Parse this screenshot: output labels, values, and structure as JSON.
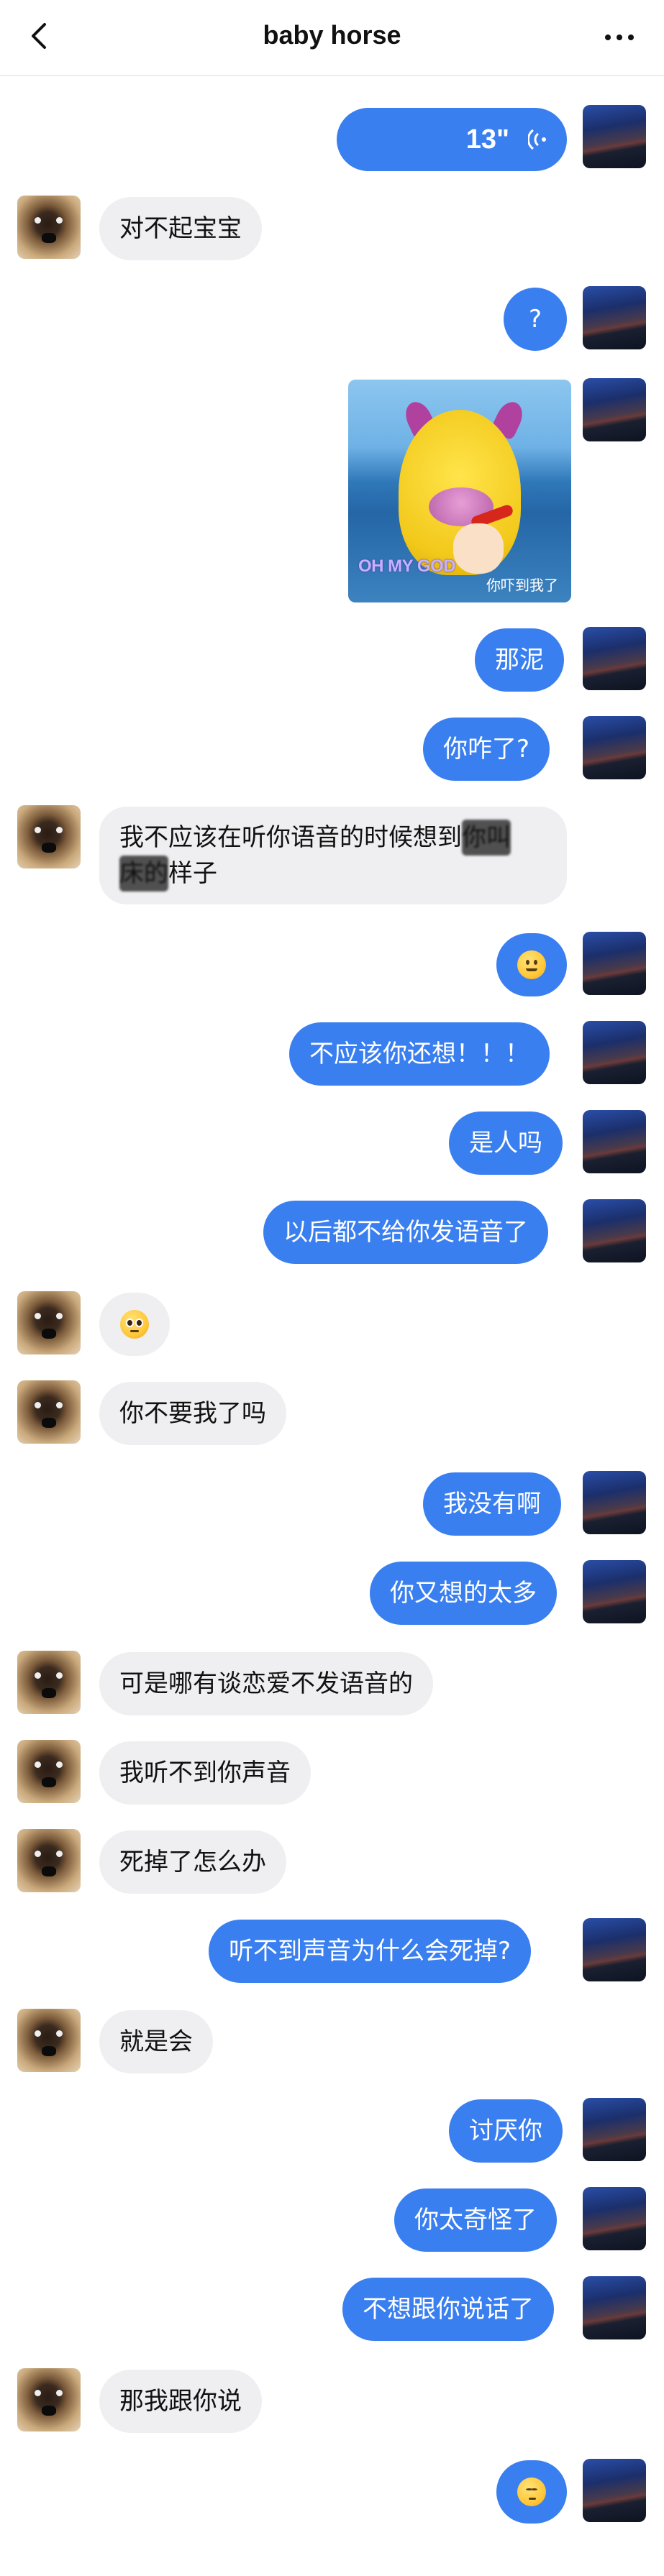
{
  "header": {
    "title": "baby horse"
  },
  "messages": {
    "m01": {
      "duration": "13\""
    },
    "m02": {
      "text": "对不起宝宝"
    },
    "m03": {
      "text": "?"
    },
    "m04": {
      "omg": "OH MY GOD",
      "caption": "你吓到我了"
    },
    "m05": {
      "text": "那泥"
    },
    "m06": {
      "text": "你咋了?"
    },
    "m07": {
      "line1_a": "我不应该在听你语音的时候想到",
      "line1_b": "你叫",
      "line2_a": "床的",
      "line2_b": "样子"
    },
    "m08": {
      "emoji": "slightly-smiling-face"
    },
    "m09": {
      "text": "不应该你还想！！！"
    },
    "m10": {
      "text": "是人吗"
    },
    "m11": {
      "text": "以后都不给你发语音了"
    },
    "m12": {
      "emoji": "pleading-face"
    },
    "m13": {
      "text": "你不要我了吗"
    },
    "m14": {
      "text": "我没有啊"
    },
    "m15": {
      "text": "你又想的太多"
    },
    "m16": {
      "text": "可是哪有谈恋爱不发语音的"
    },
    "m17": {
      "text": "我听不到你声音"
    },
    "m18": {
      "text": "死掉了怎么办"
    },
    "m19": {
      "text": "听不到声音为什么会死掉?"
    },
    "m20": {
      "text": "就是会"
    },
    "m21": {
      "text": "讨厌你"
    },
    "m22": {
      "text": "你太奇怪了"
    },
    "m23": {
      "text": "不想跟你说话了"
    },
    "m24": {
      "text": "那我跟你说"
    },
    "m25": {
      "emoji": "unamused-face"
    }
  },
  "icons": {
    "back": "chevron-left-icon",
    "more": "more-horizontal-icon",
    "voice": "voice-wave-icon"
  },
  "colors": {
    "outgoing_bubble": "#3a7ff0",
    "incoming_bubble": "#efeff1",
    "outgoing_text": "#ffffff",
    "incoming_text": "#111111"
  }
}
